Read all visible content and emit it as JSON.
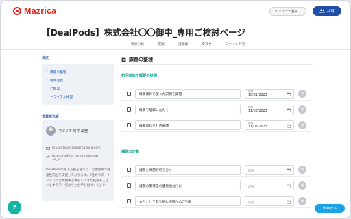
{
  "header": {
    "logo_text": "Mazrica",
    "member_select": "メンバー一覧4",
    "share_label": "共有"
  },
  "page_title": "【DealPods】株式会社〇〇御中_専用ご検討ページ",
  "tabs": [
    {
      "label": "現状分析"
    },
    {
      "label": "提案"
    },
    {
      "label": "議事録"
    },
    {
      "label": "タスク"
    },
    {
      "label": "ファイル共有"
    }
  ],
  "active_tab": "タスク",
  "sidebar": {
    "toc_heading": "目次",
    "toc_items": [
      {
        "label": "課題の整理"
      },
      {
        "label": "要件定義"
      },
      {
        "label": "ご提案"
      },
      {
        "label": "トライアル検証"
      }
    ],
    "rep_heading": "営業担当者",
    "rep_name": "マツリカ 竹中 蔵聖",
    "rep_email": "ryusei.takenaka@mazrica.com",
    "rep_url_1": "https://twitter.com/dragonsai",
    "rep_url_2": "es_cs",
    "rep_desc": "DealPodsの導入支援を通じて、営業組織の生産性向上を支援しております。2社のスタートアップで営業組織を牽引してきた経験もございますので、何なりとお申し付けください"
  },
  "main": {
    "title": "課題の整理",
    "sections": [
      {
        "heading": "初回面談で概要の説明",
        "tasks": [
          {
            "text": "概要資料を使った説明を実施",
            "due_label": "期限",
            "due": "10/31/2023",
            "owner": "マ"
          },
          {
            "text": "概要を理解いただく",
            "due_label": "期限",
            "due": "11/03/2023",
            "owner": "中"
          },
          {
            "text": "概要資料を社内展開",
            "due_label": "期限",
            "due": "11/03/2023",
            "owner": "中"
          }
        ]
      },
      {
        "heading": "課題の定義",
        "tasks": [
          {
            "text": "課題と問題の切り分け",
            "due_label": "",
            "due": "期限",
            "owner": "中"
          },
          {
            "text": "課題の重要度の優先順位付け",
            "due_label": "",
            "due": "期限",
            "owner": "中"
          },
          {
            "text": "会社として取り組む課題かのご判断",
            "due_label": "",
            "due": "期限",
            "owner": "中"
          }
        ]
      }
    ]
  },
  "help_label": "?",
  "chat_label": "チャット",
  "colors": {
    "brand_red": "#e2261b",
    "primary_blue": "#1f4fa6",
    "teal": "#16a394",
    "chat_blue": "#1aa3e8"
  }
}
